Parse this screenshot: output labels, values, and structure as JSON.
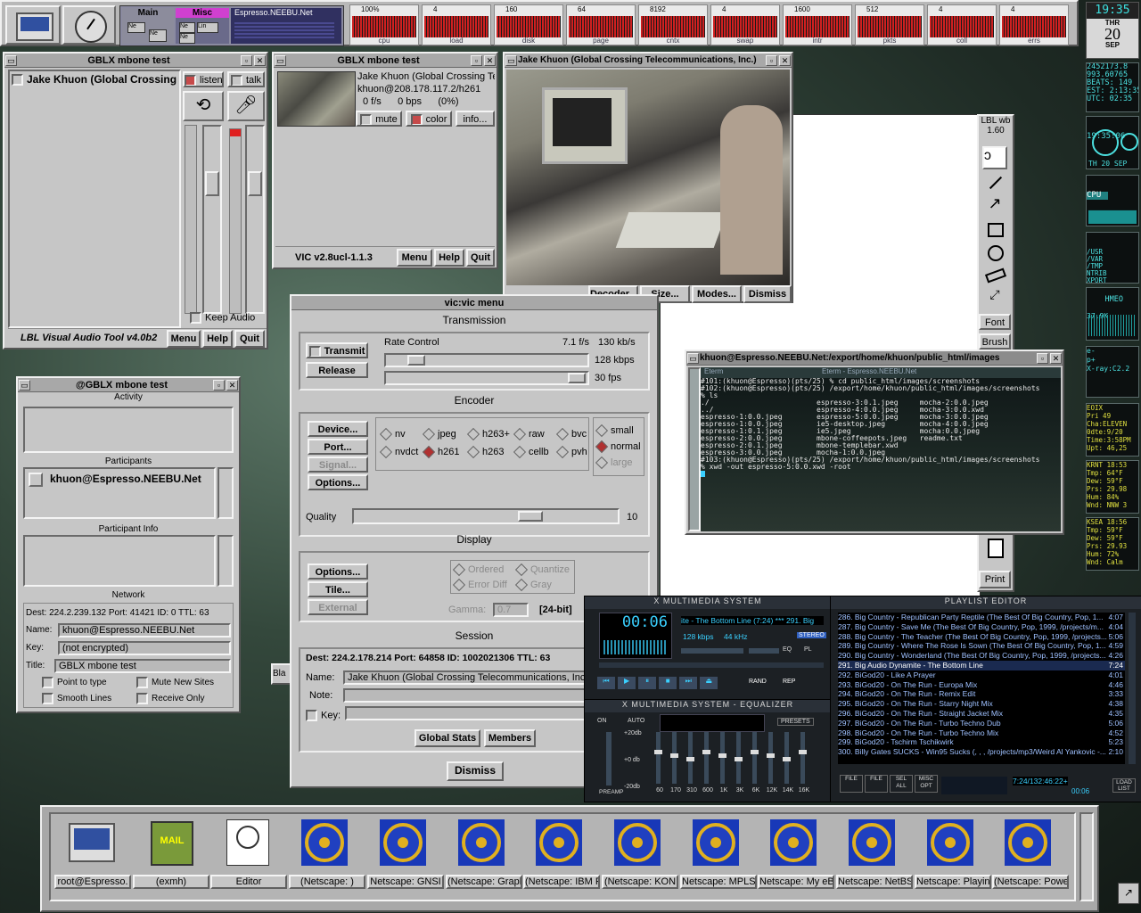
{
  "topbar": {
    "pager": {
      "main": "Main",
      "misc": "Misc",
      "hostname": "Espresso.NEEBU.Net",
      "cells": [
        "Ne",
        "Ne",
        "Lin",
        "Ne",
        "Ne"
      ]
    },
    "meters": [
      {
        "top": "100%",
        "bottom": "cpu"
      },
      {
        "top": "4",
        "bottom": "load"
      },
      {
        "top": "160",
        "bottom": "disk"
      },
      {
        "top": "64",
        "bottom": "page"
      },
      {
        "top": "8192",
        "bottom": "cntx"
      },
      {
        "top": "4",
        "bottom": "swap"
      },
      {
        "top": "1600",
        "bottom": "intr"
      },
      {
        "top": "512",
        "bottom": "pkts"
      },
      {
        "top": "4",
        "bottom": "coll"
      },
      {
        "top": "4",
        "bottom": "errs"
      }
    ]
  },
  "dock": {
    "clock": "19:35",
    "day": "THR",
    "date": "20",
    "month": "SEP",
    "time_lines": "2452173.8\n993.60765\nBEATS: 149\nEST: 2:13:35\nUTC: 02:35",
    "clock2": "19:35:06",
    "clock2_b": "TH 20 SEP",
    "cpu_label": "CPU",
    "disk_lines": "/USR\n/VAR\n/TMP\nNTRIB\nXPORT\n/OPT\nESSPO",
    "hmeo": "HMEO",
    "hmeo_rate": "37.9K",
    "xray": "e-\np+\nX-ray:C2.2",
    "wx1": "EOIX\nPri 49\nCha:ELEVEN\n0dte:9/20\nTime:3:58PM\nUpt: 46,25",
    "wx2": "KRNT 18:53\nTmp: 64°F\nDew: 59°F\nPrs: 29.98\nHum: 84%\nWnd: NNW 3",
    "wx3": "KSEA 18:56\nTmp: 59°F\nDew: 59°F\nPrs: 29.93\nHum: 72%\nWnd: Calm"
  },
  "vat": {
    "title": "GBLX mbone test",
    "participant": "Jake Khuon (Global Crossing",
    "listen": "listen",
    "talk": "talk",
    "keep_audio": "Keep Audio",
    "footer": "LBL Visual Audio Tool v4.0b2",
    "menu": "Menu",
    "help": "Help",
    "quit": "Quit"
  },
  "vat_info": {
    "title": "@GBLX mbone test",
    "activity": "Activity",
    "participants": "Participants",
    "participant": "khuon@Espresso.NEEBU.Net",
    "participant_info": "Participant Info",
    "network": "Network",
    "dest": "Dest: 224.2.239.132  Port: 41421  ID: 0  TTL: 63",
    "name_label": "Name:",
    "name_value": "khuon@Espresso.NEEBU.Net",
    "key_label": "Key:",
    "key_value": "(not encrypted)",
    "title_label": "Title:",
    "title_value": "GBLX mbone test",
    "point_to_type": "Point to type",
    "mute_new_sites": "Mute New Sites",
    "smooth_lines": "Smooth Lines",
    "receive_only": "Receive Only"
  },
  "vic": {
    "title": "GBLX mbone test",
    "source_name": "Jake Khuon (Global Crossing Te",
    "source_addr": "khuon@208.178.117.2/h261",
    "stats": "0 f/s      0 bps      (0%)",
    "mute": "mute",
    "color": "color",
    "info": "info...",
    "version": "VIC v2.8ucl-1.1.3",
    "menu": "Menu",
    "help": "Help",
    "quit": "Quit"
  },
  "video": {
    "title": "Jake Khuon (Global Crossing Telecommunications, Inc.)",
    "decoder": "Decoder...",
    "size": "Size...",
    "modes": "Modes...",
    "dismiss": "Dismiss"
  },
  "vicmenu": {
    "title": "vic:vic menu",
    "transmission": "Transmission",
    "transmit": "Transmit",
    "release": "Release",
    "rate_control": "Rate Control",
    "rate_fps": "7.1 f/s",
    "rate_kbs": "130 kb/s",
    "kbps": "128 kbps",
    "fps": "30 fps",
    "encoder": "Encoder",
    "device": "Device...",
    "port": "Port...",
    "signal": "Signal...",
    "options": "Options...",
    "codecs_row1": [
      "nv",
      "jpeg",
      "h263+",
      "raw",
      "bvc"
    ],
    "codecs_row2": [
      "nvdct",
      "h261",
      "h263",
      "cellb",
      "pvh"
    ],
    "size_small": "small",
    "size_normal": "normal",
    "size_large": "large",
    "quality": "Quality",
    "quality_value": "10",
    "display": "Display",
    "disp_options": "Options...",
    "tile": "Tile...",
    "external": "External",
    "ordered": "Ordered",
    "quantize": "Quantize",
    "error_diff": "Error Diff",
    "gray": "Gray",
    "gamma": "Gamma:",
    "gamma_value": "0.7",
    "bits": "[24-bit]",
    "session": "Session",
    "session_line": "Dest: 224.2.178.214   Port: 64858   ID: 1002021306   TTL: 63",
    "name_label": "Name:",
    "name_value": "Jake Khuon (Global Crossing Telecommunications, Inc.)",
    "note_label": "Note:",
    "key_label": "Key:",
    "global_stats": "Global Stats",
    "members": "Members",
    "dismiss": "Dismiss"
  },
  "wb": {
    "title": "LBL wb",
    "version": "1.60",
    "font": "Font",
    "brush": "Brush",
    "print": "Print",
    "bla": "Bla"
  },
  "eterm": {
    "title": "khuon@Espresso.NEEBU.Net:/export/home/khuon/public_html/images",
    "tab": "Eterm",
    "tab_title": "Eterm - Espresso.NEEBU.Net",
    "lines": [
      "#101:(khuon@Espresso)(pts/25) % cd public_html/images/screenshots",
      "#102:(khuon@Espresso)(pts/25) /export/home/khuon/public_html/images/screenshots",
      "% ls",
      "./                         espresso-3:0.1.jpeg     mocha-2:0.0.jpeg",
      "../                        espresso-4:0.0.jpeg     mocha-3:0.0.xwd",
      "espresso-1:0.0.jpeg        espresso-5:0.0.jpeg     mocha-3:0.0.jpeg",
      "espresso-1:0.0.jpeg        ie5-desktop.jpeg        mocha-4:0.0.jpeg",
      "espresso-1:0.1.jpeg        ie5.jpeg                mocha:0.0.jpeg",
      "espresso-2:0.0.jpeg        mbone-coffeepots.jpeg   readme.txt",
      "espresso-2:0.1.jpeg        mbone-templebar.xwd",
      "espresso-3:0.0.jpeg        mocha-1:0.0.jpeg",
      "#103:(khuon@Espresso)(pts/25) /export/home/khuon/public_html/images/screenshots",
      "% xwd -out espresso-5:0.0.xwd -root"
    ]
  },
  "xmms": {
    "main_title": "X MULTIMEDIA SYSTEM",
    "time": "00:06",
    "song": "ite - The Bottom Line (7:24)  *** 291. Big",
    "kbps": "128 kbps",
    "khz": "44 kHz",
    "stereo": "STEREO",
    "eq_btn": "EQ",
    "pl_btn": "PL",
    "rand": "RAND",
    "rep": "REP",
    "eq_title": "X MULTIMEDIA SYSTEM - EQUALIZER",
    "on": "ON",
    "auto": "AUTO",
    "presets": "PRESETS",
    "db_top": "+20db",
    "db_mid": "+0 db",
    "db_bot": "-20db",
    "preamp": "PREAMP",
    "bands": [
      "60",
      "170",
      "310",
      "600",
      "1K",
      "3K",
      "6K",
      "12K",
      "14K",
      "16K"
    ],
    "pl_title": "PLAYLIST EDITOR",
    "playlist": [
      {
        "t": "286. Big Country - Republican Party Reptile (The Best Of Big Country, Pop, 1...",
        "d": "4:07"
      },
      {
        "t": "287. Big Country - Save Me (The Best Of Big Country, Pop, 1999, /projects/m...",
        "d": "4:04"
      },
      {
        "t": "288. Big Country - The Teacher (The Best Of Big Country, Pop, 1999, /projects...",
        "d": "5:06"
      },
      {
        "t": "289. Big Country - Where The Rose Is Sown (The Best Of Big Country, Pop, 1...",
        "d": "4:59"
      },
      {
        "t": "290. Big Country - Wonderland (The Best Of Big Country, Pop, 1999, /projects...",
        "d": "4:26"
      },
      {
        "t": "291. Big Audio Dynamite - The Bottom Line",
        "d": "7:24"
      },
      {
        "t": "292. BiGod20 - Like A Prayer",
        "d": "4:01"
      },
      {
        "t": "293. BiGod20 - On The Run - Europa Mix",
        "d": "4:46"
      },
      {
        "t": "294. BiGod20 - On The Run - Remix Edit",
        "d": "3:33"
      },
      {
        "t": "295. BiGod20 - On The Run - Starry Night Mix",
        "d": "4:38"
      },
      {
        "t": "296. BiGod20 - On The Run - Straight Jacket Mix",
        "d": "4:35"
      },
      {
        "t": "297. BiGod20 - On The Run - Turbo Techno Dub",
        "d": "5:06"
      },
      {
        "t": "298. BiGod20 - On The Run - Turbo Techno Mix",
        "d": "4:52"
      },
      {
        "t": "299. BiGod20 - Tschirm Tschikwirk",
        "d": "5:23"
      },
      {
        "t": "300. Billy Gates SUCKS - Win95 Sucks (, , , /projects/mp3/Weird Al Yankovic -...",
        "d": "2:10"
      }
    ],
    "pl_buttons": [
      "FILE",
      "FILE",
      "SEL ALL",
      "MISC OPT"
    ],
    "pl_time": "7:24/132:46:22+",
    "pl_time2": "00:06",
    "load_list": "LOAD LIST"
  },
  "taskbar": {
    "items": [
      "root@Espresso.",
      "(exmh)",
      "Editor",
      "(Netscape: )",
      "Netscape: GNSI",
      "(Netscape: Graph",
      "(Netscape: IBM F",
      "(Netscape: KON",
      "Netscape: MPLS",
      "Netscape: My eB",
      "Netscape: NetBS",
      "Netscape: Playin",
      "(Netscape: Powe"
    ],
    "mail": "MAIL"
  },
  "colors": {
    "accent_red": "#c63a3a",
    "xmms_blue": "#3ad0ff",
    "pl_selected": "#ffffff"
  }
}
